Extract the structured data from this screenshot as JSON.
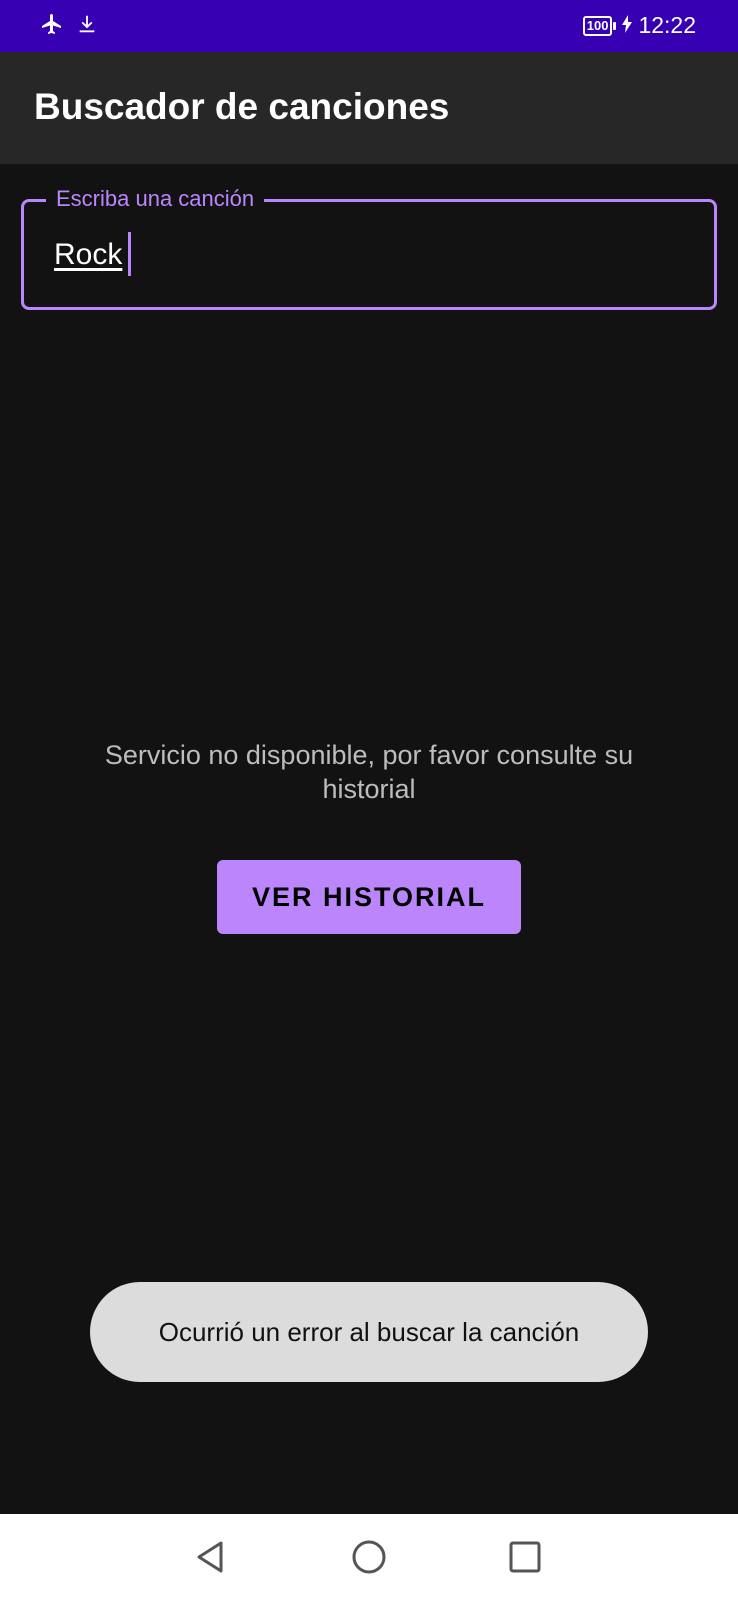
{
  "status_bar": {
    "icons_left": [
      "airplane-mode-icon",
      "download-icon"
    ],
    "battery_level": "100",
    "time": "12:22"
  },
  "app_bar": {
    "title": "Buscador de canciones"
  },
  "search": {
    "label": "Escriba una canción",
    "value": "Rock"
  },
  "main": {
    "message": "Servicio no disponible, por favor consulte su historial",
    "history_button": "VER HISTORIAL"
  },
  "toast": {
    "text": "Ocurrió un error al buscar la canción"
  },
  "nav_bar": {
    "icons": [
      "back-icon",
      "home-icon",
      "recents-icon"
    ]
  },
  "colors": {
    "status_bar": "#3700B3",
    "app_bar": "#272727",
    "background": "#121212",
    "accent": "#BB86FC",
    "toast": "#DCDCDC"
  }
}
